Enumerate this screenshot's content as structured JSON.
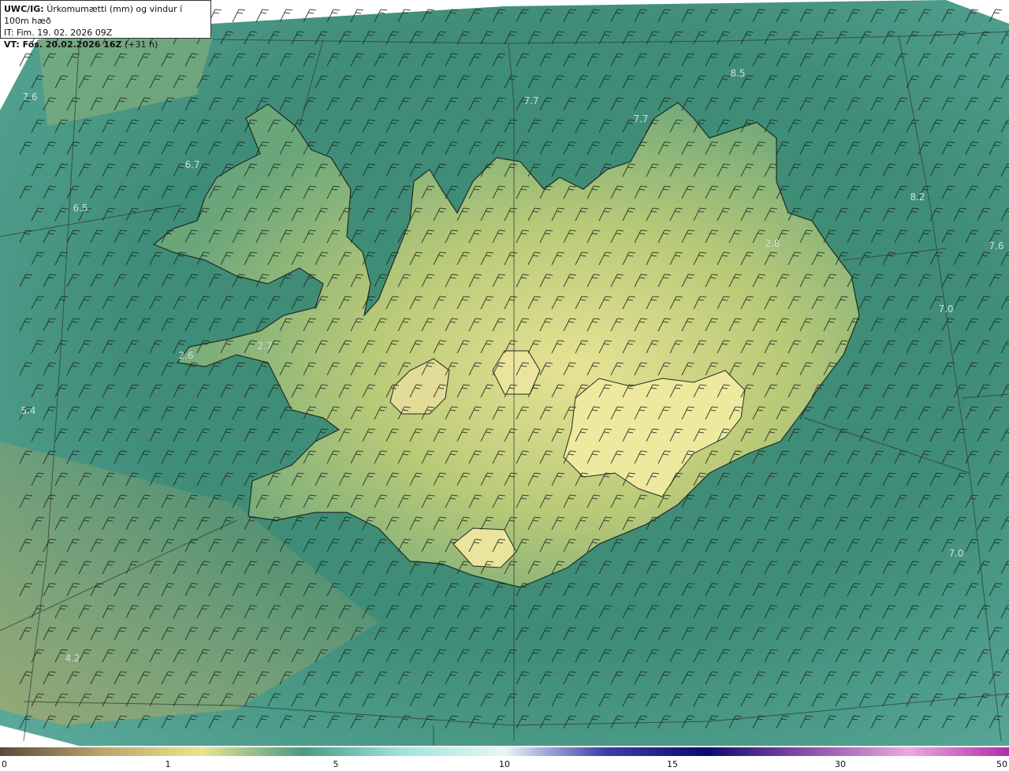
{
  "header": {
    "product": "UWC/IG:",
    "title_rest": "Úrkomumætti (mm) og vindur í 100m hæð",
    "issue_time": "IT: Fim. 19. 02. 2026 09Z",
    "valid_prefix": "VT: Fös. 20.02.2026 16Z",
    "valid_suffix": "(+31 h)"
  },
  "colorbar": {
    "ticks": [
      "0",
      "1",
      "5",
      "10",
      "15",
      "30",
      "50"
    ],
    "colors": [
      "#5a4a3a",
      "#b9a56a",
      "#e9e48f",
      "#4a9a86",
      "#9fe5dc",
      "#e8f6f6",
      "#3b3fa8",
      "#0b0b6a",
      "#8a4fa8",
      "#e9a9e0",
      "#b02fa8"
    ]
  },
  "map_labels": [
    {
      "text": "7.6"
    },
    {
      "text": "7.7"
    },
    {
      "text": "8.5"
    },
    {
      "text": "7.7"
    },
    {
      "text": "6.7"
    },
    {
      "text": "6.5"
    },
    {
      "text": "8.2"
    },
    {
      "text": "7.6"
    },
    {
      "text": "2.8"
    },
    {
      "text": "7.0"
    },
    {
      "text": "2.7"
    },
    {
      "text": "2.6"
    },
    {
      "text": "5.4"
    },
    {
      "text": "7.0"
    },
    {
      "text": "4.2"
    }
  ]
}
